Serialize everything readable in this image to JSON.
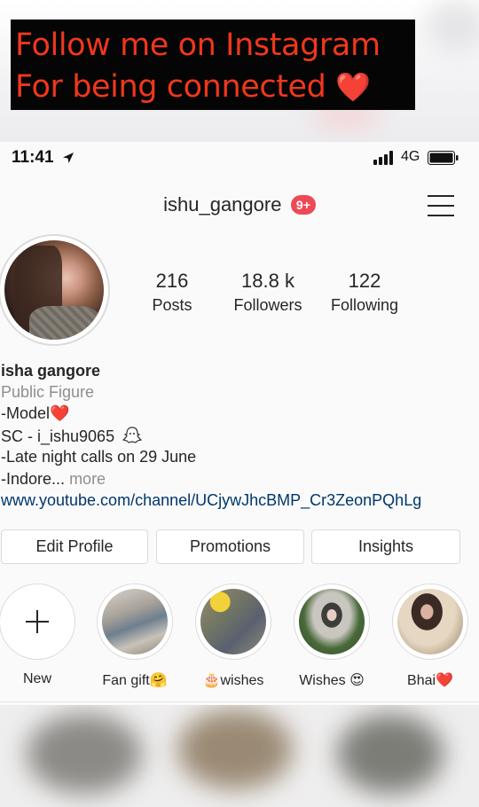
{
  "banner": {
    "line1": "Follow me on Instagram",
    "line2": "For being connected",
    "emoji": "❤️"
  },
  "status_bar": {
    "time": "11:41",
    "network": "4G"
  },
  "profile": {
    "username": "ishu_gangore",
    "notification_count": "9+",
    "stats": [
      {
        "value": "216",
        "label": "Posts"
      },
      {
        "value": "18.8 k",
        "label": "Followers"
      },
      {
        "value": "122",
        "label": "Following"
      }
    ],
    "bio": {
      "name": "isha gangore",
      "category": "Public Figure",
      "line1": "-Model",
      "line1_emoji": "❤️",
      "line2": "SC - i_ishu9065",
      "line3": "-Late night calls on 29 June",
      "line4": "-Indore...",
      "more": "more",
      "link": "www.youtube.com/channel/UCjywJhcBMP_Cr3ZeonPQhLg"
    },
    "buttons": {
      "edit_profile": "Edit Profile",
      "promotions": "Promotions",
      "insights": "Insights"
    },
    "highlights": [
      {
        "label": "New"
      },
      {
        "label": "Fan gift🤗"
      },
      {
        "label": "🎂wishes"
      },
      {
        "label": "Wishes 😍"
      },
      {
        "label": "Bhai❤️"
      }
    ]
  },
  "colors": {
    "banner_text": "#f0371c",
    "badge": "#ed4956",
    "link": "#00376b",
    "muted": "#8e8e8e"
  }
}
